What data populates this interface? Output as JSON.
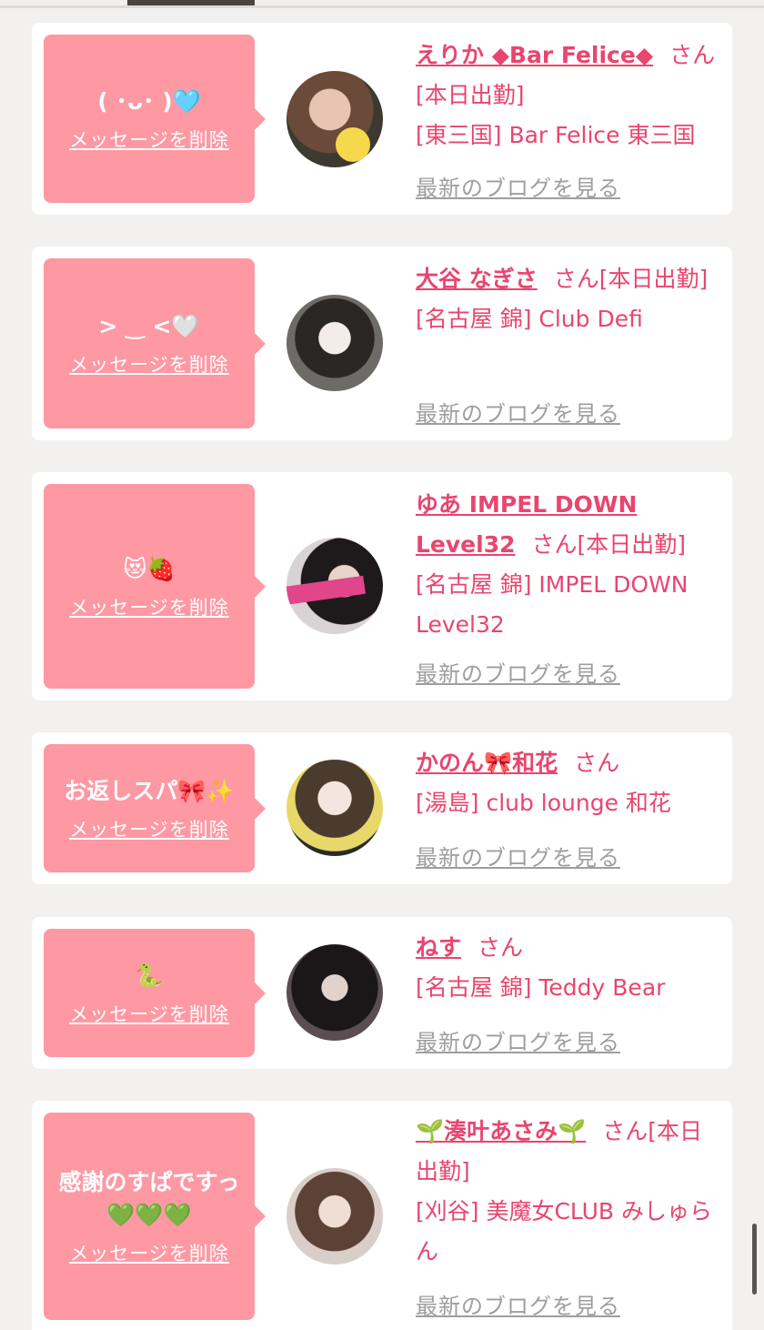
{
  "delete_label": "メッセージを削除",
  "blog_label": "最新のブログを見る",
  "san": "さん",
  "cards": [
    {
      "message": "( ･ᴗ･ )🩵",
      "name": "えりか ◆Bar Felice◆",
      "status": "[本日出勤]",
      "shop": "[東三国] Bar Felice 東三国"
    },
    {
      "message": "> ‿ <🤍",
      "name": "大谷 なぎさ",
      "status": "[本日出勤]",
      "shop": "[名古屋 錦] Club Defi"
    },
    {
      "message": "😻🍓",
      "name": "ゆあ IMPEL DOWN Level32",
      "status": "[本日出勤]",
      "shop": "[名古屋 錦] IMPEL DOWN Level32"
    },
    {
      "message": "お返しスパ🎀✨",
      "name": "かのん🎀和花",
      "status": "",
      "shop": "[湯島] club lounge 和花"
    },
    {
      "message": "🐍",
      "name": "ねす",
      "status": "",
      "shop": "[名古屋 錦] Teddy Bear"
    },
    {
      "message": "感謝のすぱですっ💚💚💚",
      "name": "🌱湊叶あさみ🌱",
      "status": "[本日出勤]",
      "shop": "[刈谷] 美魔女CLUB みしゅらん"
    }
  ]
}
